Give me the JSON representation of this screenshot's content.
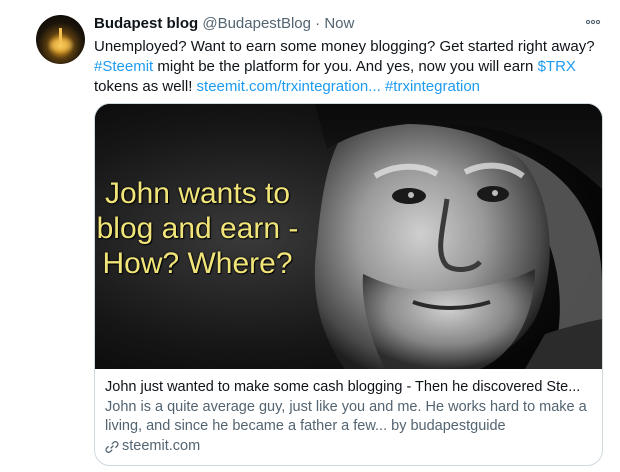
{
  "account": {
    "name": "Budapest blog",
    "handle": "@BudapestBlog",
    "separator": "·",
    "time": "Now"
  },
  "tweet": {
    "part1": "Unemployed? Want to earn some money blogging? Get started right away? ",
    "hashtag_steemit": "#Steemit",
    "part2": " might be the platform for you. And yes, now you will earn ",
    "cashtag": "$TRX",
    "part3": " tokens as well! ",
    "url": "steemit.com/trxintegration...",
    "hashtag_trx": "#trxintegration"
  },
  "card": {
    "overlay_text": "John wants to blog and earn - How? Where?",
    "title": "John just wanted to make some cash blogging - Then he discovered Ste...",
    "description": "John is a quite average guy, just like you and me. He works hard to make a living, and since he became a father a few... by budapestguide",
    "domain": "steemit.com"
  },
  "colors": {
    "link": "#1d9bf0",
    "muted": "#536471",
    "overlay_text": "#f1e57a"
  },
  "icons": [
    "more-options-icon",
    "link-icon"
  ]
}
